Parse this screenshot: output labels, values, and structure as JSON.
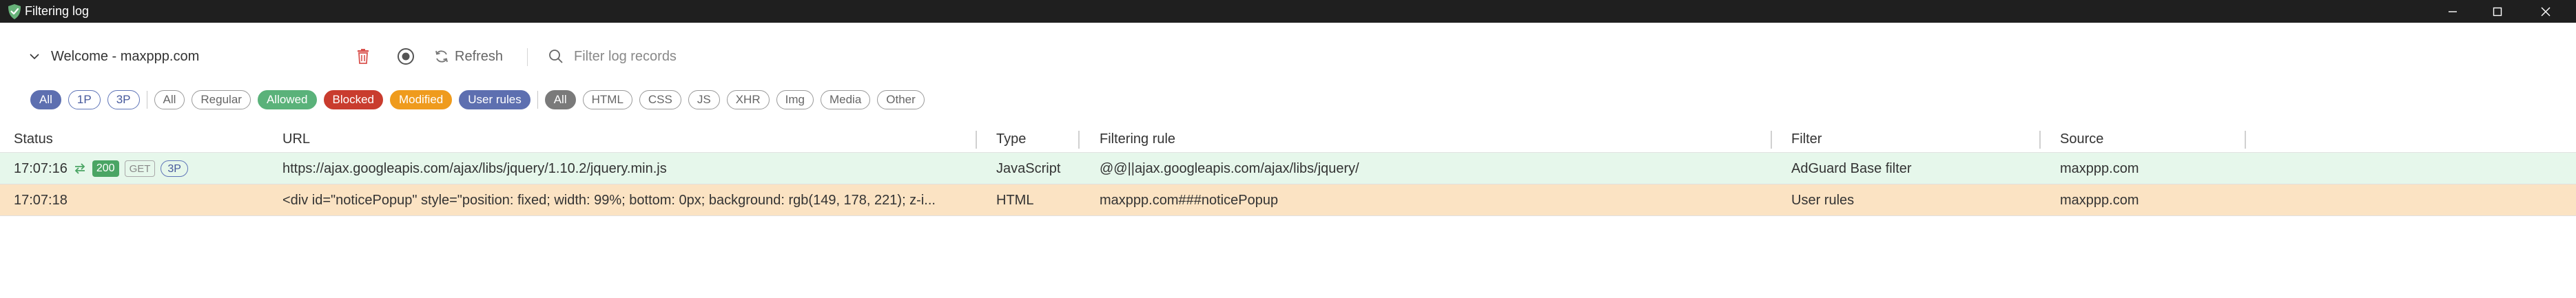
{
  "window": {
    "title": "Filtering log",
    "controls": {
      "minimize": "minimize-icon",
      "maximize": "maximize-icon",
      "close": "close-icon"
    }
  },
  "toolbar": {
    "site_selector": "Welcome - maxppp.com",
    "clear_icon": "trash-icon",
    "record_icon": "record-icon",
    "refresh_label": "Refresh",
    "search_placeholder": "Filter log records"
  },
  "filters": {
    "party": [
      "All",
      "1P",
      "3P"
    ],
    "status": [
      "All",
      "Regular",
      "Allowed",
      "Blocked",
      "Modified",
      "User rules"
    ],
    "type": [
      "All",
      "HTML",
      "CSS",
      "JS",
      "XHR",
      "Img",
      "Media",
      "Other"
    ]
  },
  "table": {
    "columns": [
      "Status",
      "URL",
      "Type",
      "Filtering rule",
      "Filter",
      "Source"
    ],
    "rows": [
      {
        "time": "17:07:16",
        "code": "200",
        "method": "GET",
        "party": "3P",
        "url": "https://ajax.googleapis.com/ajax/libs/jquery/1.10.2/jquery.min.js",
        "type": "JavaScript",
        "rule": "@@||ajax.googleapis.com/ajax/libs/jquery/",
        "filter": "AdGuard Base filter",
        "source": "maxppp.com"
      },
      {
        "time": "17:07:18",
        "url": "<div id=\"noticePopup\" style=\"position: fixed; width: 99%; bottom: 0px; background: rgb(149, 178, 221); z-i...",
        "type": "HTML",
        "rule": "maxppp.com###noticePopup",
        "filter": "User rules",
        "source": "maxppp.com"
      }
    ]
  },
  "colors": {
    "allowed_row": "#e6f7eb",
    "blocked_row": "#fbe3c3",
    "accent_blue": "#5d6fb0",
    "allowed_green": "#5ab27a",
    "blocked_red": "#c93c2e",
    "modified_orange": "#ef9b1d",
    "delete_red": "#d9534f",
    "logo_green": "#67b279"
  }
}
